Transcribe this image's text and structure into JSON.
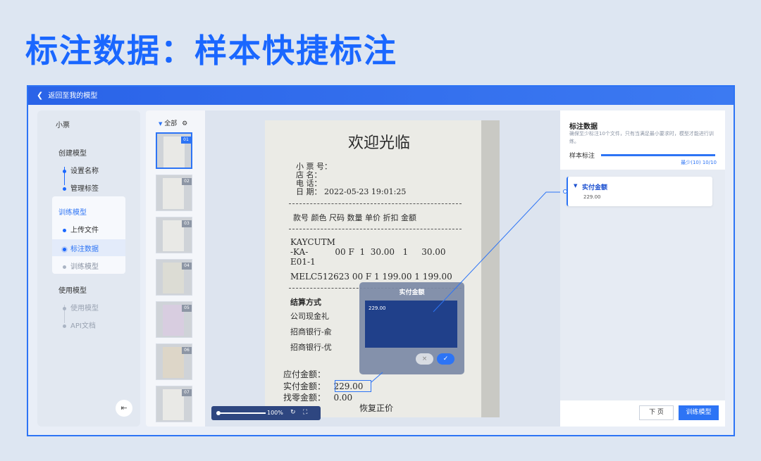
{
  "headline": "标注数据：样本快捷标注",
  "topbar": {
    "back_label": "返回至我的模型"
  },
  "nav": {
    "model_name": "小票",
    "create_section": "创建模型",
    "create_items": [
      "设置名称",
      "管理标签"
    ],
    "train_section": "训练模型",
    "train_items": [
      "上传文件",
      "标注数据",
      "训练模型"
    ],
    "use_section": "使用模型",
    "use_items": [
      "使用模型",
      "API文档"
    ]
  },
  "thumbs": {
    "filter_label": "全部",
    "numbers": [
      "01",
      "02",
      "03",
      "04",
      "05",
      "06",
      "07"
    ]
  },
  "receipt": {
    "title": "欢迎光临",
    "info_lines": [
      "小 票 号：",
      "店    名：",
      "电    话：",
      "日    期：  2022-05-23 19:01:25"
    ],
    "header": "款号  颜色  尺码  数量  单价  折扣  金额",
    "item1a": "KAYCUTM",
    "item1b": "-KA-          00 F  1  30.00   1     30.00",
    "item1c": "E01-1",
    "item2": "MELC512623 00 F  1 199.00  1   199.00",
    "settle": "结算方式",
    "settle1": "公司现金礼",
    "settle2": "招商银行-兪",
    "settle3": "招商银行-优",
    "due": "应付金额：",
    "paid": "实付金额：   229.00",
    "change": "找零金额：   0.00",
    "restore": "恢复正价"
  },
  "popup": {
    "title": "实付金额",
    "value": "229.00",
    "cancel_icon": "×",
    "ok_icon": "✓"
  },
  "zoom": {
    "percent": "100%",
    "slider_value": 0
  },
  "right_panel": {
    "title": "标注数据",
    "description": "确保至少标注10个文件，只有当满足最小要求时，模型才能进行训练。",
    "progress_label": "样本标注",
    "progress_count": "最少(10) 10/10",
    "progress_fraction": 1.0,
    "card_title": "实付金额",
    "card_value": "229.00",
    "next_button": "下 页",
    "train_button": "训练模型"
  },
  "colors": {
    "accent": "#2d74f5",
    "headline": "#1a67ff",
    "popup_body": "#20408a"
  }
}
